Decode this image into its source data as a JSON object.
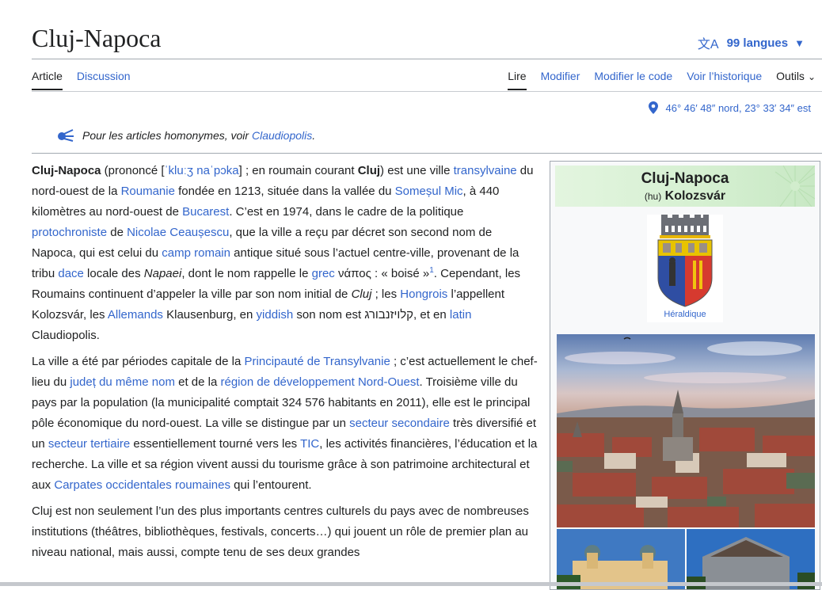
{
  "page": {
    "title": "Cluj-Napoca",
    "languages_label": "99 langues"
  },
  "tabs": {
    "left": [
      "Article",
      "Discussion"
    ],
    "right": [
      "Lire",
      "Modifier",
      "Modifier le code",
      "Voir l’historique",
      "Outils"
    ]
  },
  "coordinates": "46° 46′ 48″ nord, 23° 33′ 34″ est",
  "hatnote": {
    "prefix": "Pour les articles homonymes, voir ",
    "link": "Claudiopolis",
    "suffix": "."
  },
  "p1": {
    "t0": "Cluj-Napoca",
    "t1": " (prononcé [",
    "ipa1": "ˈkluːʒ naˈpɔka",
    "t2": "] ; en roumain courant ",
    "t3": "Cluj",
    "t4": ") est une ville ",
    "l1": "transylvaine",
    "t5": " du nord-ouest de la ",
    "l2": "Roumanie",
    "t6": " fondée en 1213, située dans la vallée du ",
    "l3": "Someșul Mic",
    "t7": ", à 440 kilomètres au nord-ouest de ",
    "l4": "Bucarest",
    "t8": ". C’est en 1974, dans le cadre de la politique ",
    "l5": "protochroniste",
    "t9": " de ",
    "l6": "Nicolae Ceaușescu",
    "t10": ", que la ville a reçu par décret son second nom de Napoca, qui est celui du ",
    "l7": "camp romain",
    "t11": " antique situé sous l’actuel centre-ville, provenant de la tribu ",
    "l8": "dace",
    "t12": " locale des ",
    "i1": "Napaei",
    "t13": ", dont le nom rappelle le ",
    "l9": "grec",
    "t14": " νάπος : « boisé »",
    "sup": "1",
    "t15": ". Cependant, les Roumains continuent d’appeler la ville par son nom initial de ",
    "i2": "Cluj",
    "t16": " ; les ",
    "l10": "Hongrois",
    "t17": " l’appellent Kolozsvár, les ",
    "l11": "Allemands",
    "t18": " Klausenburg, en ",
    "l12": "yiddish",
    "t19": " son nom est קלויזנבורג, et en ",
    "l13": "latin",
    "t20": " Claudiopolis."
  },
  "p2": {
    "t0": "La ville a été par périodes capitale de la ",
    "l1": "Principauté de Transylvanie",
    "t1": " ; c’est actuellement le chef-lieu du ",
    "l2": "județ du même nom",
    "t2": " et de la ",
    "l3": "région de développement Nord-Ouest",
    "t3": ". Troisième ville du pays par la population (la municipalité comptait 324 576 habitants en 2011), elle est le principal pôle économique du nord-ouest. La ville se distingue par un ",
    "l4": "secteur secondaire",
    "t4": " très diversifié et un ",
    "l5": "secteur tertiaire",
    "t5": " essentiellement tourné vers les ",
    "l6": "TIC",
    "t6": ", les activités financières, l’éducation et la recherche. La ville et sa région vivent aussi du tourisme grâce à son patrimoine architectural et aux ",
    "l7": "Carpates occidentales roumaines",
    "t7": " qui l’entourent."
  },
  "p3": {
    "t0": "Cluj est non seulement l’un des plus importants centres culturels du pays avec de nombreuses institutions (théâtres, bibliothèques, festivals, concerts…) qui jouent un rôle de premier plan au niveau national, mais aussi, compte tenu de ses deux grandes"
  },
  "infobox": {
    "name": "Cluj-Napoca",
    "lang_code": "(hu)",
    "alt_name": "Kolozsvár",
    "arms_caption": "Héraldique"
  }
}
